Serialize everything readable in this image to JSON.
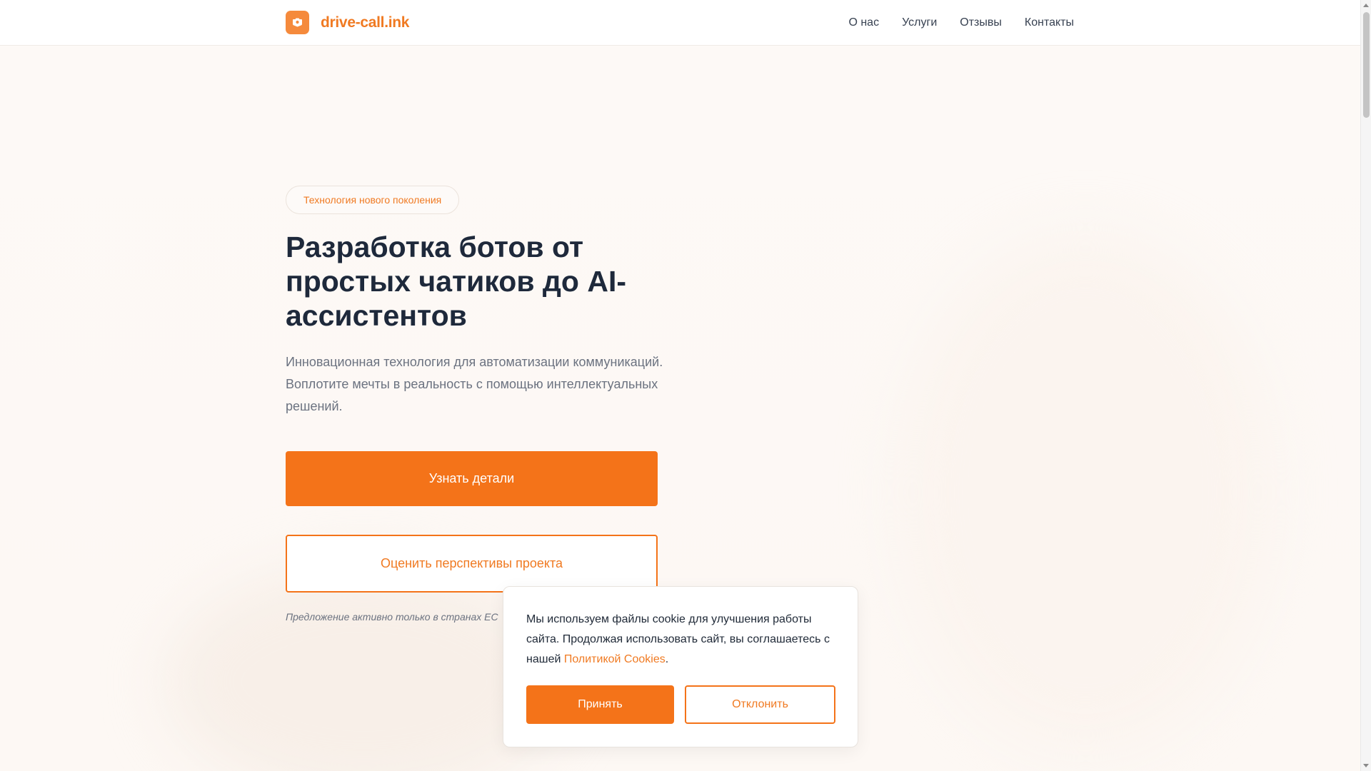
{
  "brand": {
    "name": "drive-call.ink",
    "accent": "#f47319",
    "logo_icon": "camera-shield-icon"
  },
  "nav": {
    "items": [
      {
        "label": "О нас"
      },
      {
        "label": "Услуги"
      },
      {
        "label": "Отзывы"
      },
      {
        "label": "Контакты"
      }
    ]
  },
  "hero": {
    "badge": "Технология нового поколения",
    "title": "Разработка ботов от простых чатиков до AI-ассистентов",
    "description": "Инновационная технология для автоматизации коммуникаций. Воплотите мечты в реальность с помощью интеллектуальных решений.",
    "primary_button": "Узнать детали",
    "secondary_button": "Оценить перспективы проекта",
    "note": "Предложение активно только в странах ЕС"
  },
  "cookie": {
    "text_before_link": "Мы используем файлы cookie для улучшения работы сайта. Продолжая использовать сайт, вы соглашаетесь с нашей ",
    "link_text": "Политикой Cookies",
    "text_after_link": ".",
    "accept_label": "Принять",
    "decline_label": "Отклонить"
  }
}
